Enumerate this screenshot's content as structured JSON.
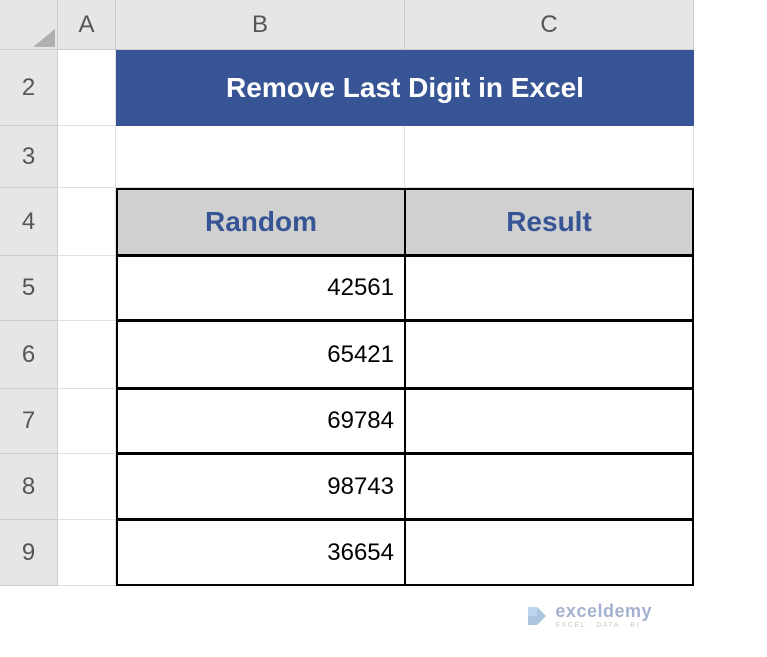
{
  "columns": [
    "A",
    "B",
    "C"
  ],
  "rows": [
    "2",
    "3",
    "4",
    "5",
    "6",
    "7",
    "8",
    "9"
  ],
  "title": "Remove Last Digit in Excel",
  "table": {
    "headers": [
      "Random",
      "Result"
    ],
    "data": [
      {
        "random": "42561",
        "result": ""
      },
      {
        "random": "65421",
        "result": ""
      },
      {
        "random": "69784",
        "result": ""
      },
      {
        "random": "98743",
        "result": ""
      },
      {
        "random": "36654",
        "result": ""
      }
    ]
  },
  "watermark": {
    "main": "exceldemy",
    "sub": "EXCEL · DATA · BI"
  }
}
